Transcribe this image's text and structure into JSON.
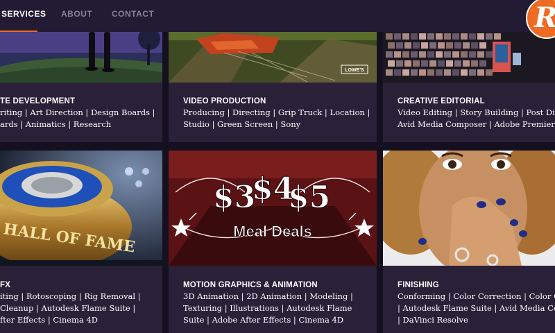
{
  "nav": {
    "items": [
      {
        "label": "SERVICES",
        "active": true
      },
      {
        "label": "ABOUT",
        "active": false
      },
      {
        "label": "CONTACT",
        "active": false
      }
    ],
    "accent_color": "#ef6a22"
  },
  "logo": {
    "glyph": "R"
  },
  "tiles": [
    {
      "title": "TE DEVELOPMENT",
      "lines": [
        "riting | Art Direction | Design Boards |",
        "ards | Animatics | Research"
      ]
    },
    {
      "title": "VIDEO PRODUCTION",
      "lines": [
        "Producing | Directing | Grip Truck | Location |",
        "Studio | Green Screen | Sony"
      ],
      "image_text": "LOWE'S"
    },
    {
      "title": "CREATIVE EDITORIAL",
      "lines": [
        "Video Editing | Story Building | Post Direc",
        "Avid Media Composer | Adobe Premier Pr"
      ]
    },
    {
      "title": "FX",
      "lines": [
        "iting | Rotoscoping | Rig Removal |",
        "Cleanup | Autodesk Flame Suite |",
        "fter Effects | Cinema 4D"
      ],
      "image_text": "HALL OF FAME"
    },
    {
      "title": "MOTION GRAPHICS & ANIMATION",
      "lines": [
        "3D Animation | 2D Animation | Modeling |",
        "Texturing | Illustrations | Autodesk Flame",
        "Suite | Adobe After Effects | Cinema 4D"
      ],
      "image_text": {
        "prices": [
          "$3",
          "$4",
          "$5"
        ],
        "banner": "Meal Deals"
      }
    },
    {
      "title": "FINISHING",
      "lines": [
        "Conforming | Color Correction | Color Gra",
        "| Autodesk Flame Suite | Avid Media Comp",
        "| DaVinci Resolve"
      ]
    }
  ]
}
